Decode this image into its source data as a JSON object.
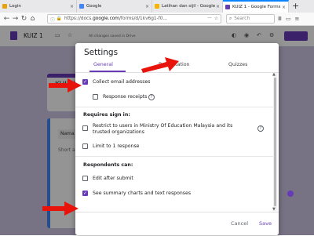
{
  "browser": {
    "tabs": [
      {
        "label": "Login",
        "close": "×"
      },
      {
        "label": "Google",
        "close": "×"
      },
      {
        "label": "Latihan dan sijil - Google Dri...",
        "close": "×"
      },
      {
        "label": "KUIZ 1 - Google Forms",
        "close": "×"
      }
    ],
    "new_tab": "+",
    "url_prefix": "https://docs.",
    "url_host": "google.com",
    "url_rest": "/forms/d/1kv6g1-f0...",
    "url_more": "···",
    "search_placeholder": "Search",
    "icons": [
      "back-icon",
      "forward-icon",
      "reload-icon",
      "home-icon",
      "info-icon",
      "lock-icon",
      "bookmark-star-icon",
      "search-icon",
      "library-icon",
      "sidebar-icon",
      "menu-icon"
    ],
    "colors": {
      "accent": "#0a84ff",
      "tab_google": "#4285f4",
      "tab_drive": "#f4b400",
      "tab_forms": "#673ab7",
      "tab_login": "#e8a20c"
    }
  },
  "form": {
    "title": "KUIZ 1",
    "saved_status": "All changes saved in Drive",
    "title_card": "KUIZ 1",
    "question_field": "Nama",
    "short_answer": "Short ans...",
    "accent": "#673ab7"
  },
  "settings": {
    "title": "Settings",
    "tabs": [
      "General",
      "Presentation",
      "Quizzes"
    ],
    "options": {
      "collect_email": {
        "label": "Collect email addresses",
        "checked": true
      },
      "response_receipts": {
        "label": "Response receipts",
        "checked": false
      },
      "requires_sign_in": "Requires sign in:",
      "restrict_users": {
        "label": "Restrict to users in Ministry Of Education Malaysia and its trusted organizations",
        "checked": false
      },
      "limit_one": {
        "label": "Limit to 1 response",
        "checked": false
      },
      "respondents_can": "Respondents can:",
      "edit_after_submit": {
        "label": "Edit after submit",
        "checked": false
      },
      "see_summary": {
        "label": "See summary charts and text responses",
        "checked": true
      }
    },
    "help_glyph": "?",
    "check_glyph": "✓",
    "cancel": "Cancel",
    "save": "Save"
  },
  "annotations": {
    "arrow_color": "#e8140c"
  }
}
